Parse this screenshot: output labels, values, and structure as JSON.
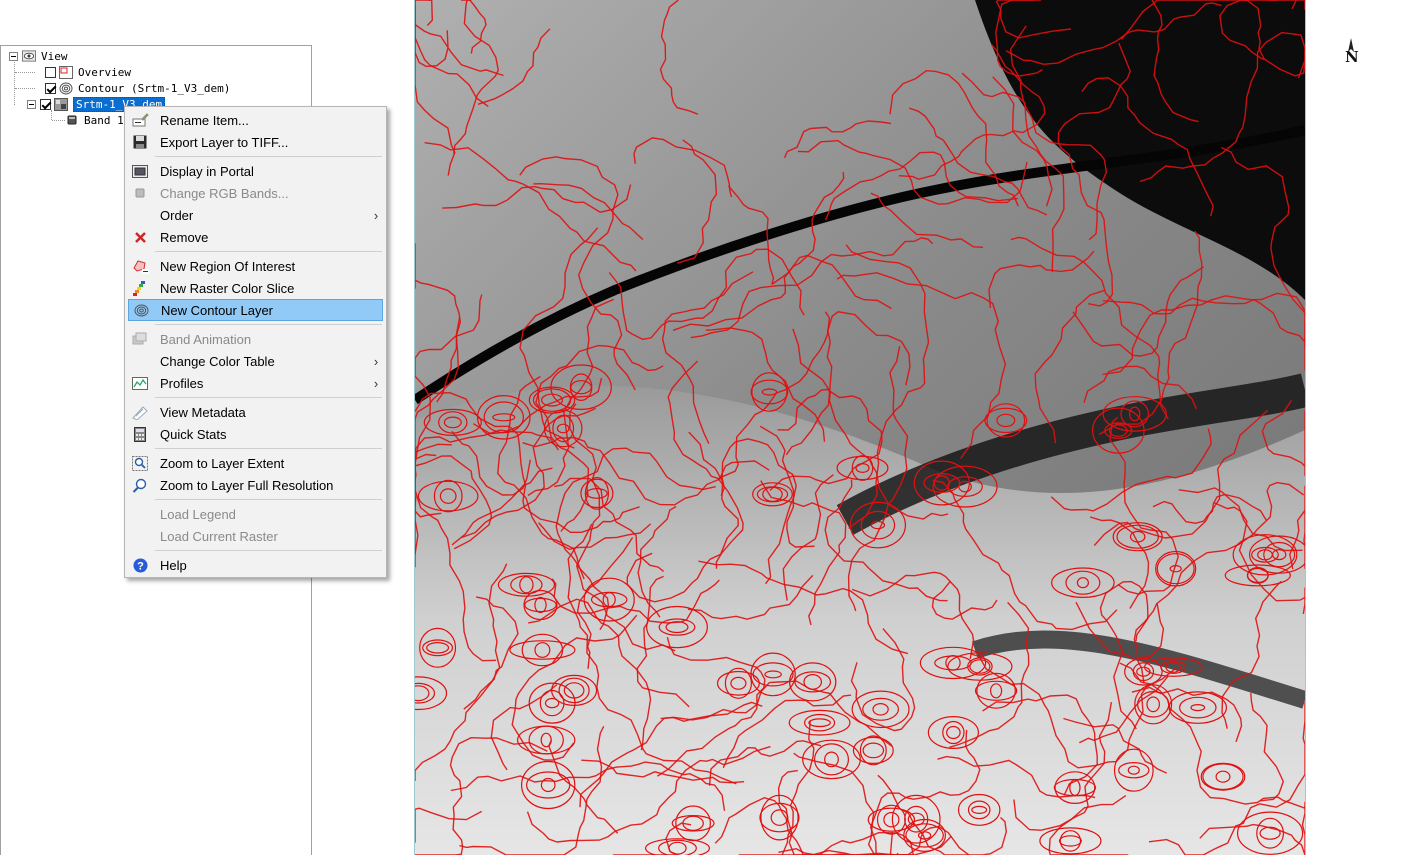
{
  "layer_tree": {
    "root_label": "View",
    "items": [
      {
        "label": "Overview",
        "checked": false
      },
      {
        "label": "Contour (Srtm-1_V3_dem)",
        "checked": true
      },
      {
        "label": "Srtm-1_V3_dem",
        "checked": true,
        "selected": true
      },
      {
        "label": "Band 1"
      }
    ]
  },
  "context_menu": {
    "items": [
      {
        "label": "Rename Item...",
        "icon": "rename-icon",
        "enabled": true
      },
      {
        "label": "Export Layer to TIFF...",
        "icon": "floppy-disk-icon",
        "enabled": true
      },
      {
        "label": "Display in Portal",
        "icon": "portal-icon",
        "enabled": true
      },
      {
        "label": "Change RGB Bands...",
        "icon": "rgb-bands-icon",
        "enabled": false
      },
      {
        "label": "Order",
        "icon": "",
        "enabled": true,
        "submenu": true
      },
      {
        "label": "Remove",
        "icon": "red-x-icon",
        "enabled": true
      },
      {
        "label": "New Region Of Interest",
        "icon": "roi-icon",
        "enabled": true
      },
      {
        "label": "New Raster Color Slice",
        "icon": "color-slice-icon",
        "enabled": true
      },
      {
        "label": "New Contour Layer",
        "icon": "contour-icon",
        "enabled": true,
        "highlighted": true
      },
      {
        "label": "Band Animation",
        "icon": "band-animation-icon",
        "enabled": false
      },
      {
        "label": "Change Color Table",
        "icon": "",
        "enabled": true,
        "submenu": true
      },
      {
        "label": "Profiles",
        "icon": "profiles-icon",
        "enabled": true,
        "submenu": true
      },
      {
        "label": "View Metadata",
        "icon": "metadata-icon",
        "enabled": true
      },
      {
        "label": "Quick Stats",
        "icon": "calculator-icon",
        "enabled": true
      },
      {
        "label": "Zoom to Layer Extent",
        "icon": "zoom-extent-icon",
        "enabled": true
      },
      {
        "label": "Zoom to Layer Full Resolution",
        "icon": "zoom-full-icon",
        "enabled": true
      },
      {
        "label": "Load Legend",
        "icon": "",
        "enabled": false
      },
      {
        "label": "Load Current Raster",
        "icon": "",
        "enabled": false
      },
      {
        "label": "Help",
        "icon": "help-icon",
        "enabled": true
      }
    ],
    "submenu_arrow": "›"
  },
  "map": {
    "north_label": "N",
    "contour_color": "#e01010"
  }
}
